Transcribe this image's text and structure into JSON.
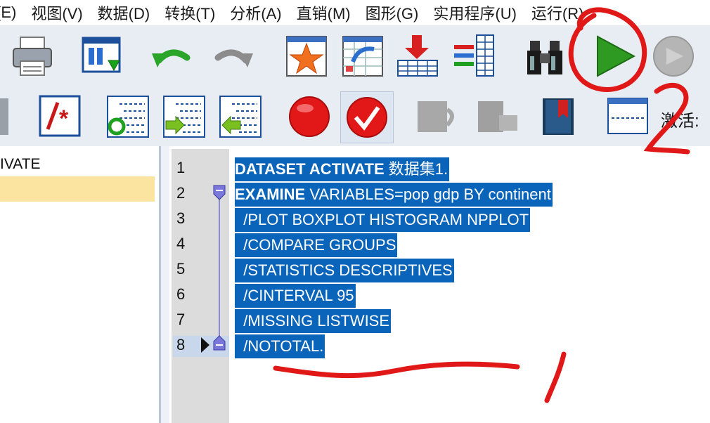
{
  "menu": [
    {
      "label": "(E)",
      "name": "menu-edit"
    },
    {
      "label": "视图(V)",
      "name": "menu-view"
    },
    {
      "label": "数据(D)",
      "name": "menu-data"
    },
    {
      "label": "转换(T)",
      "name": "menu-transform"
    },
    {
      "label": "分析(A)",
      "name": "menu-analyze"
    },
    {
      "label": "直销(M)",
      "name": "menu-direct-marketing"
    },
    {
      "label": "图形(G)",
      "name": "menu-graphs"
    },
    {
      "label": "实用程序(U)",
      "name": "menu-utilities"
    },
    {
      "label": "运行(R)",
      "name": "menu-run"
    }
  ],
  "toolbar2": {
    "activate_label": "激活:"
  },
  "left_panel": {
    "item": "IVATE"
  },
  "editor": {
    "line_numbers": [
      "1",
      "2",
      "3",
      "4",
      "5",
      "6",
      "7",
      "8"
    ],
    "lines": [
      {
        "kw": "DATASET ACTIVATE",
        "rest": " 数据集1."
      },
      {
        "kw": "EXAMINE",
        "rest": " VARIABLES=pop gdp BY continent"
      },
      {
        "kw": "",
        "rest": "  /PLOT BOXPLOT HISTOGRAM NPPLOT"
      },
      {
        "kw": "",
        "rest": "  /COMPARE GROUPS"
      },
      {
        "kw": "",
        "rest": "  /STATISTICS DESCRIPTIVES"
      },
      {
        "kw": "",
        "rest": "  /CINTERVAL 95"
      },
      {
        "kw": "",
        "rest": "  /MISSING LISTWISE"
      },
      {
        "kw": "",
        "rest": "  /NOTOTAL."
      }
    ]
  },
  "annotation": {
    "label_1": "1",
    "label_2": "2",
    "color": "#e01818"
  },
  "colors": {
    "selection": "#0a64ba",
    "gutter": "#dcdcdc",
    "toolbar": "#e8edf4",
    "row_highlight": "#fbe49f"
  }
}
